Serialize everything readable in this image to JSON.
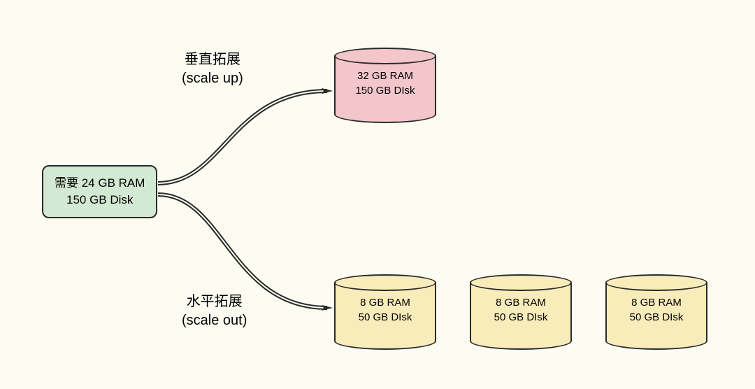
{
  "source": {
    "line1": "需要 24 GB RAM",
    "line2": "150 GB Disk"
  },
  "labels": {
    "up": {
      "line1": "垂直拓展",
      "line2": "(scale up)"
    },
    "out": {
      "line1": "水平拓展",
      "line2": "(scale out)"
    }
  },
  "targets": {
    "scaleUp": {
      "line1": "32 GB RAM",
      "line2": "150 GB DIsk"
    },
    "scaleOut1": {
      "line1": "8 GB RAM",
      "line2": "50 GB DIsk"
    },
    "scaleOut2": {
      "line1": "8 GB RAM",
      "line2": "50 GB DIsk"
    },
    "scaleOut3": {
      "line1": "8 GB RAM",
      "line2": "50 GB DIsk"
    }
  }
}
